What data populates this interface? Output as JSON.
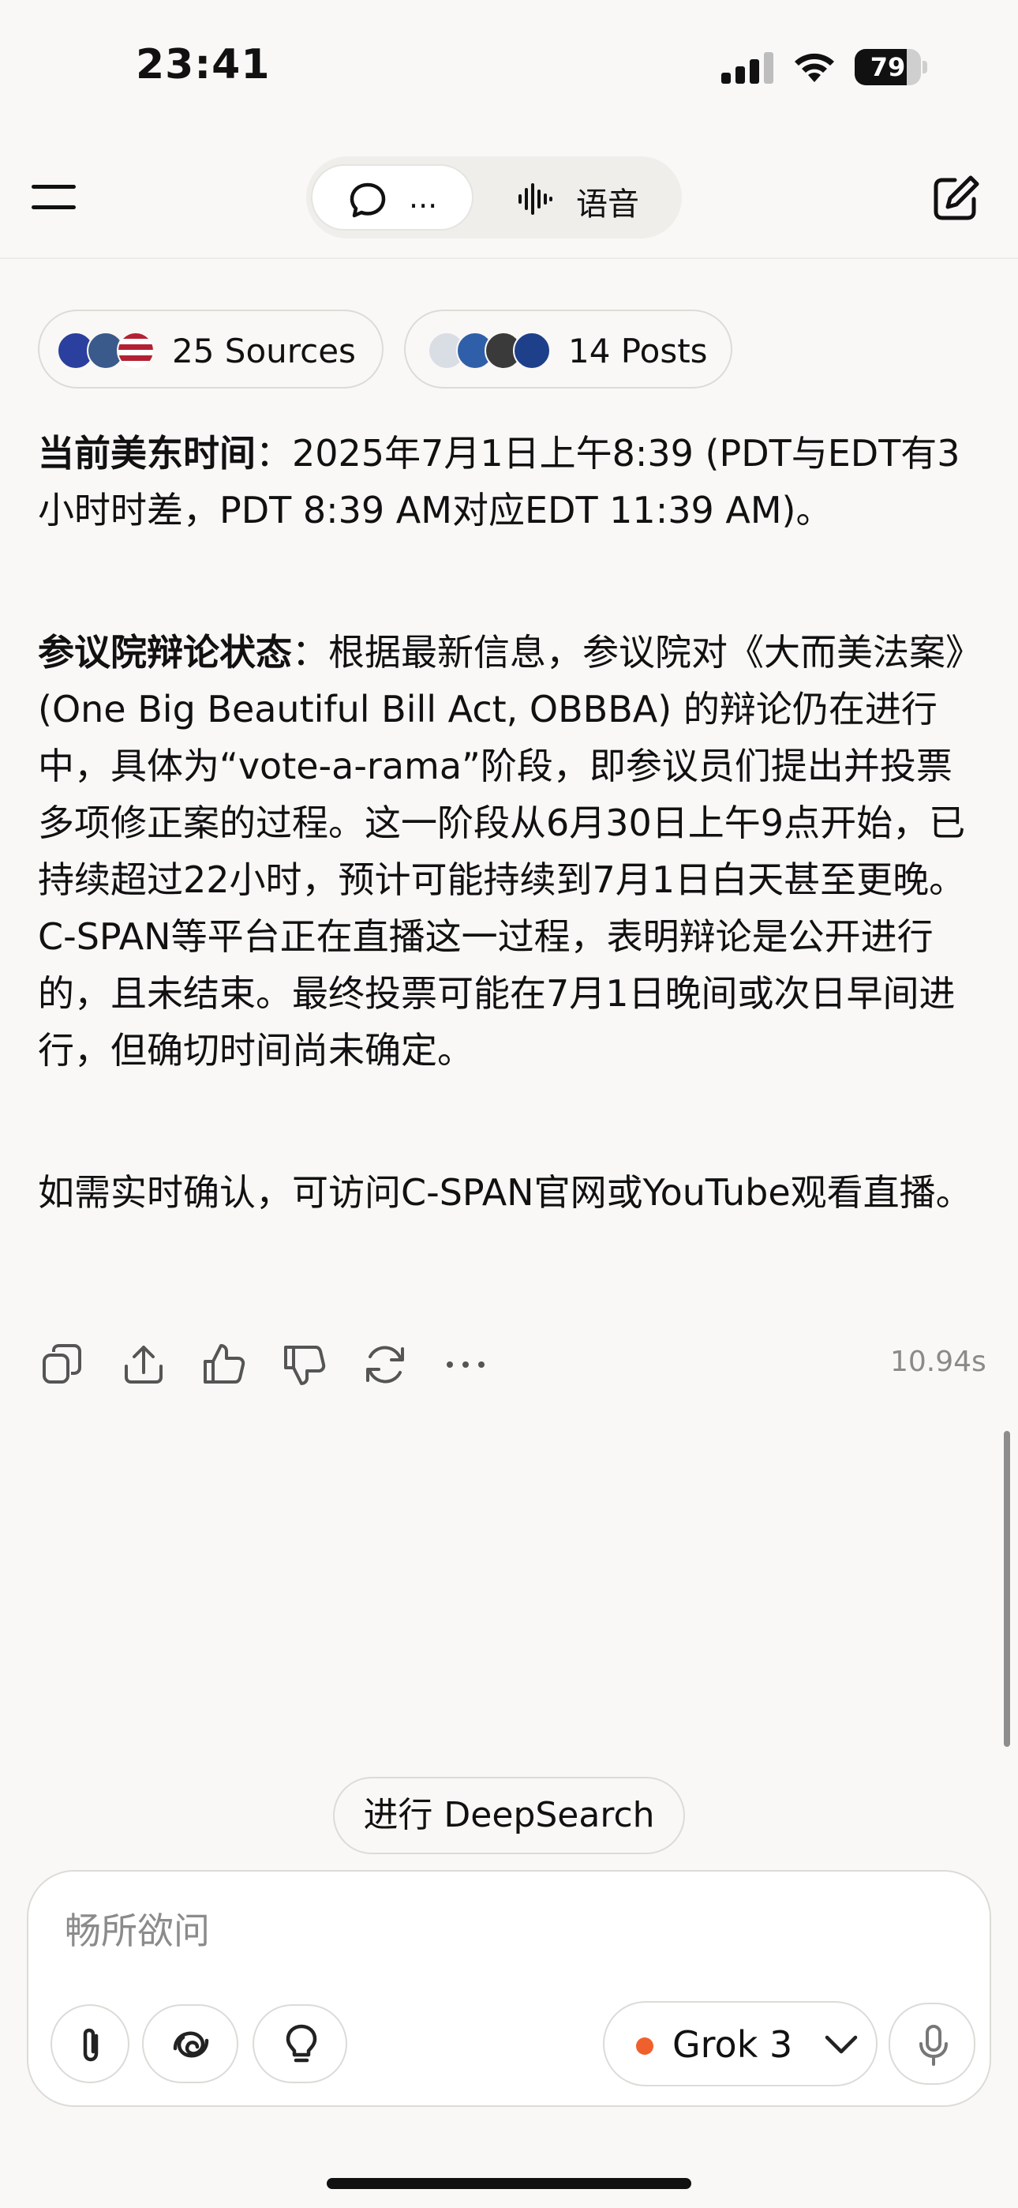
{
  "status_bar": {
    "time": "23:41",
    "battery": "79",
    "battery_level": 0.79
  },
  "nav": {
    "chat_tab_label": "...",
    "voice_tab_label": "语音"
  },
  "sources": {
    "sources_label": "25 Sources",
    "posts_label": "14 Posts"
  },
  "answer": {
    "p1_bold": "当前美东时间",
    "p1_text": "：2025年7月1日上午8:39 (PDT与EDT有3小时时差，PDT 8:39 AM对应EDT 11:39 AM)。",
    "p2_bold": "参议院辩论状态",
    "p2_text": "：根据最新信息，参议院对《大而美法案》(One Big Beautiful Bill Act, OBBBA) 的辩论仍在进行中，具体为“vote-a-rama”阶段，即参议员们提出并投票多项修正案的过程。这一阶段从6月30日上午9点开始，已持续超过22小时，预计可能持续到7月1日白天甚至更晚。C-SPAN等平台正在直播这一过程，表明辩论是公开进行的，且未结束。最终投票可能在7月1日晚间或次日早间进行，但确切时间尚未确定。",
    "p3_text": "如需实时确认，可访问C-SPAN官网或YouTube观看直播。"
  },
  "actions": {
    "elapsed": "10.94s"
  },
  "deepsearch_label": "进行 DeepSearch",
  "composer": {
    "placeholder": "畅所欲问",
    "model_label": "Grok 3"
  },
  "colors": {
    "accent": "#f0602d",
    "background": "#f9f8f6"
  },
  "icons": [
    "menu-icon",
    "chat-bubble-icon",
    "waveform-icon",
    "compose-icon",
    "copy-icon",
    "share-icon",
    "thumbs-up-icon",
    "thumbs-down-icon",
    "regenerate-icon",
    "more-icon",
    "paperclip-icon",
    "think-icon",
    "lightbulb-icon",
    "chevron-down-icon",
    "microphone-icon"
  ]
}
